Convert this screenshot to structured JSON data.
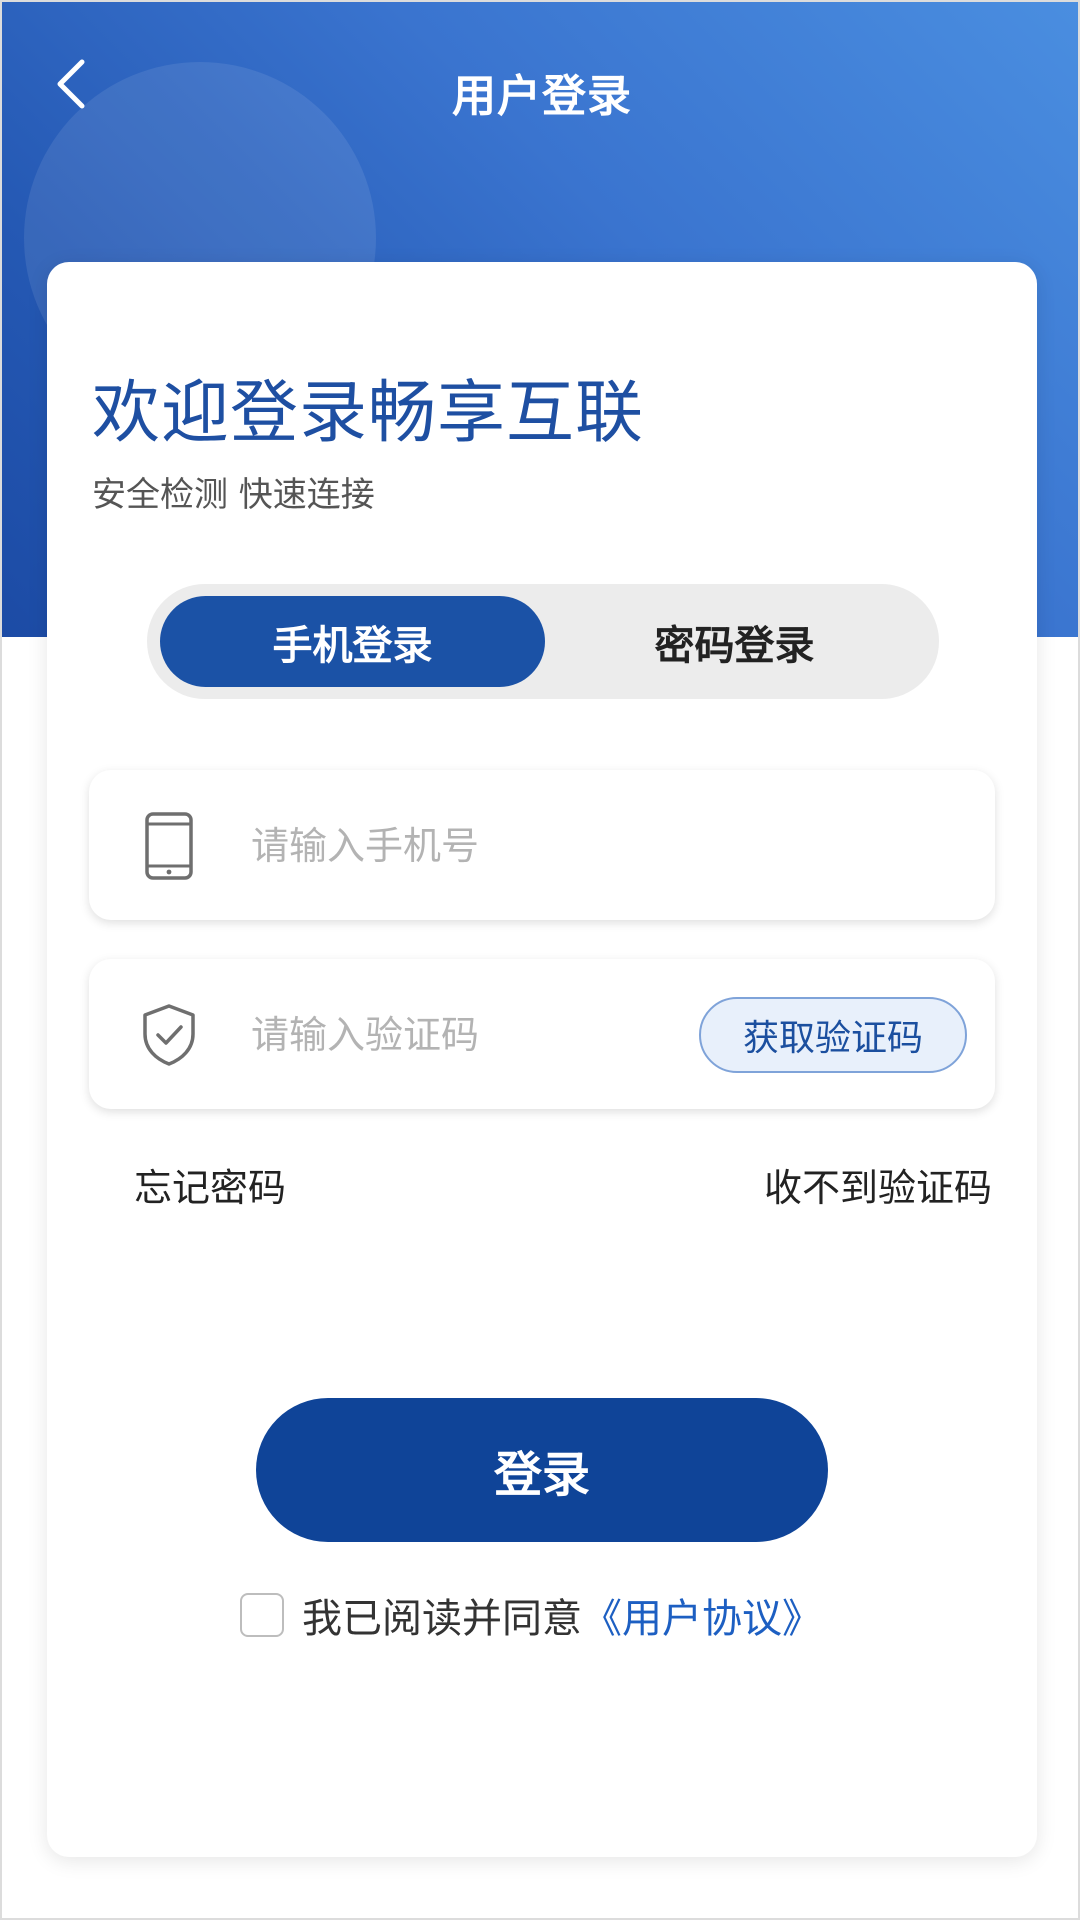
{
  "nav": {
    "title": "用户登录",
    "back_icon": "chevron-left-icon"
  },
  "welcome": {
    "title": "欢迎登录畅享互联",
    "subtitle": "安全检测 快速连接"
  },
  "tabs": [
    {
      "label": "手机登录",
      "active": true
    },
    {
      "label": "密码登录",
      "active": false
    }
  ],
  "phone_field": {
    "icon": "phone-icon",
    "value": "",
    "placeholder": "请输入手机号"
  },
  "code_field": {
    "icon": "shield-check-icon",
    "value": "",
    "placeholder": "请输入验证码",
    "get_code_label": "获取验证码"
  },
  "links": {
    "forgot_password": "忘记密码",
    "no_code": "收不到验证码"
  },
  "login_button": "登录",
  "agreement": {
    "checked": false,
    "text": "我已阅读并同意",
    "link": "《用户协议》"
  },
  "colors": {
    "primary": "#1b52a6",
    "button": "#0f4498",
    "header_gradient_start": "#4a8ee0",
    "header_gradient_end": "#1c4ba5",
    "link": "#1d5fc2"
  }
}
